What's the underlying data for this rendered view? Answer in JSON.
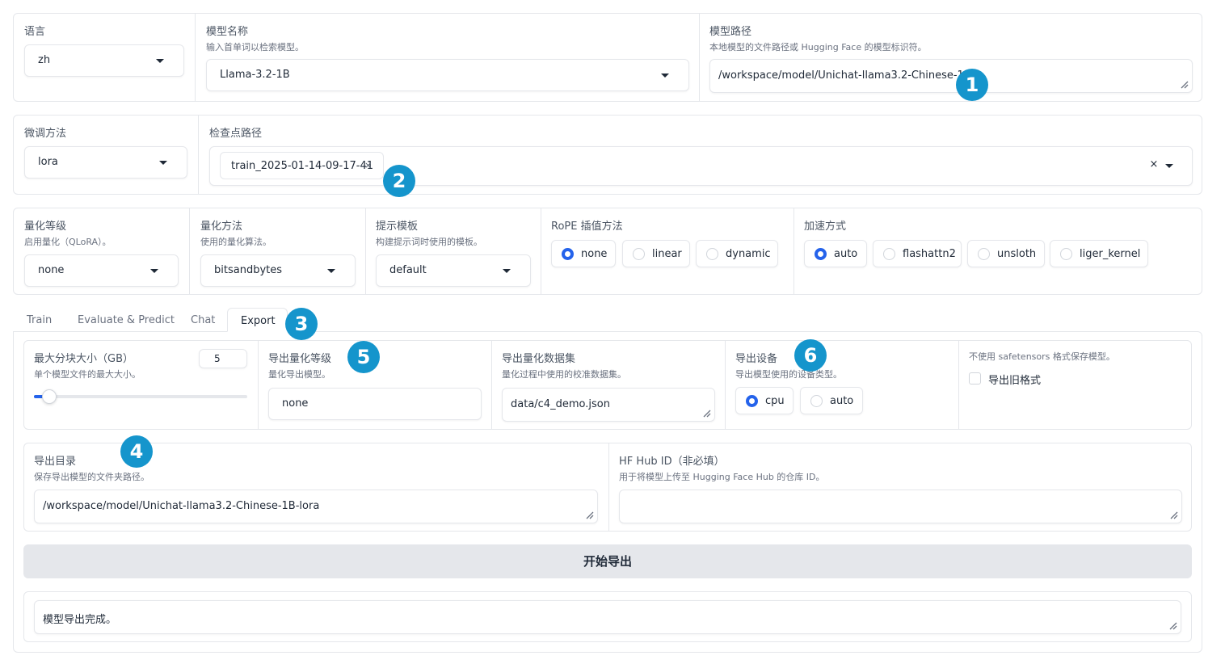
{
  "top_row": {
    "language": {
      "label": "语言",
      "value": "zh"
    },
    "model_name": {
      "label": "模型名称",
      "info": "输入首单词以检索模型。",
      "value": "Llama-3.2-1B"
    },
    "model_path": {
      "label": "模型路径",
      "info": "本地模型的文件路径或 Hugging Face 的模型标识符。",
      "value": "/workspace/model/Unichat-llama3.2-Chinese-1B"
    }
  },
  "second_row": {
    "finetune_method": {
      "label": "微调方法",
      "value": "lora"
    },
    "checkpoint_path": {
      "label": "检查点路径",
      "chip": "train_2025-01-14-09-17-41",
      "chip_close": "×",
      "clear": "×"
    }
  },
  "third_row": {
    "quant_level": {
      "label": "量化等级",
      "info": "启用量化（QLoRA）。",
      "value": "none"
    },
    "quant_method": {
      "label": "量化方法",
      "info": "使用的量化算法。",
      "value": "bitsandbytes"
    },
    "template": {
      "label": "提示模板",
      "info": "构建提示词时使用的模板。",
      "value": "default"
    },
    "rope": {
      "label": "RoPE 插值方法",
      "options": [
        "none",
        "linear",
        "dynamic"
      ],
      "selected": "none"
    },
    "booster": {
      "label": "加速方式",
      "options": [
        "auto",
        "flashattn2",
        "unsloth",
        "liger_kernel"
      ],
      "selected": "auto"
    }
  },
  "tabs": [
    {
      "label": "Train",
      "active": false
    },
    {
      "label": "Evaluate & Predict",
      "active": false
    },
    {
      "label": "Chat",
      "active": false
    },
    {
      "label": "Export",
      "active": true
    }
  ],
  "export": {
    "max_shard": {
      "label": "最大分块大小（GB）",
      "info": "单个模型文件的最大大小。",
      "value": "5",
      "slider_min": 1,
      "slider_max": 100,
      "slider_value": 5
    },
    "export_quant": {
      "label": "导出量化等级",
      "info": "量化导出模型。",
      "value": "none"
    },
    "export_dataset": {
      "label": "导出量化数据集",
      "info": "量化过程中使用的校准数据集。",
      "value": "data/c4_demo.json"
    },
    "export_device": {
      "label": "导出设备",
      "info": "导出模型使用的设备类型。",
      "options": [
        "cpu",
        "auto"
      ],
      "selected": "cpu"
    },
    "legacy": {
      "info": "不使用 safetensors 格式保存模型。",
      "label": "导出旧格式",
      "checked": false
    },
    "export_dir": {
      "label": "导出目录",
      "info": "保存导出模型的文件夹路径。",
      "value": "/workspace/model/Unichat-llama3.2-Chinese-1B-lora"
    },
    "hub_id": {
      "label": "HF Hub ID（非必填）",
      "info": "用于将模型上传至 Hugging Face Hub 的仓库 ID。",
      "value": ""
    },
    "start_button": "开始导出",
    "output": "模型导出完成。"
  },
  "annotations": [
    "1",
    "2",
    "3",
    "4",
    "5",
    "6"
  ],
  "colors": {
    "accent": "#2563eb",
    "badge": "#1595cc",
    "border": "#e5e7eb",
    "button_bg": "#e5e7eb"
  }
}
